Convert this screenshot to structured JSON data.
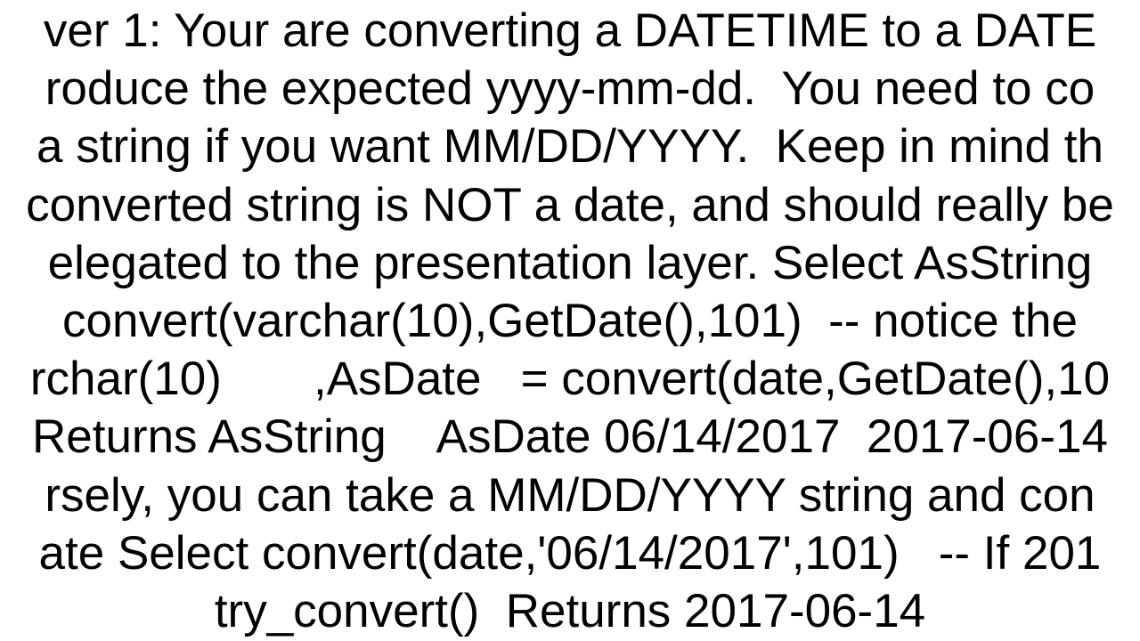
{
  "content": {
    "line1": "ver 1: Your are converting a DATETIME to a DATE",
    "line2": "roduce the expected yyyy-mm-dd.  You need to co",
    "line3": "a string if you want MM/DD/YYYY.  Keep in mind th",
    "line4": "converted string is NOT a date, and should really be",
    "line5": "elegated to the presentation layer. Select AsString",
    "line6": "convert(varchar(10),GetDate(),101)  -- notice the",
    "line7": "rchar(10)       ,AsDate   = convert(date,GetDate(),10",
    "line8": "Returns AsString    AsDate 06/14/2017  2017-06-14",
    "line9": "rsely, you can take a MM/DD/YYYY string and con",
    "line10": "ate Select convert(date,'06/14/2017',101)   -- If 201",
    "line11": "try_convert()  Returns 2017-06-14"
  }
}
